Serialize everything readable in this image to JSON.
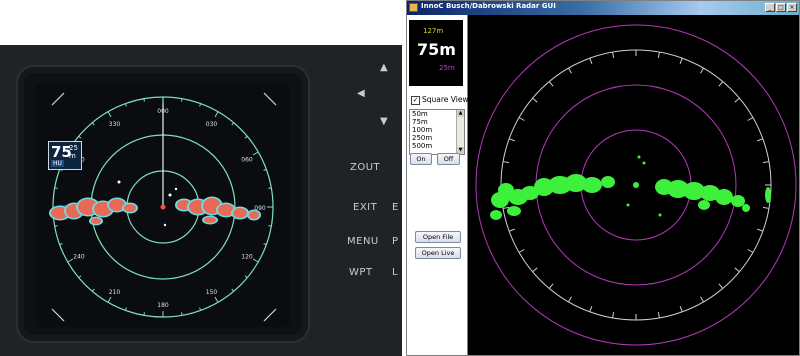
{
  "photo": {
    "range_value": "75",
    "range_unit_top": "25",
    "range_unit_bottom": "m",
    "mode_badge": "HU",
    "bearing_labels": [
      "000",
      "030",
      "060",
      "090",
      "120",
      "150",
      "180",
      "210",
      "240",
      "270",
      "300",
      "330"
    ],
    "side_buttons": [
      "ZOUT",
      "EXIT",
      "MENU",
      "WPT"
    ],
    "side_button_subs": [
      "E",
      "P",
      "L"
    ],
    "colors": {
      "target": "#e86a55",
      "ring": "#7fe0c0",
      "screen": "#0a0c10"
    }
  },
  "window": {
    "title": "InnoC Busch/Dabrowski Radar GUI",
    "minimize_label": "_",
    "maximize_label": "□",
    "close_label": "×",
    "readout": {
      "top_value": "127m",
      "main_value": "75m",
      "bottom_value": "25m"
    },
    "square_view": {
      "label": "Square View",
      "checked": true,
      "check_mark": "✓"
    },
    "range_options": [
      "50m",
      "75m",
      "100m",
      "250m",
      "500m"
    ],
    "scroll_up_icon": "▲",
    "scroll_down_icon": "▼",
    "on_label": "On",
    "off_label": "Off",
    "open_file_label": "Open File",
    "open_live_label": "Open Live",
    "colors": {
      "target": "#3cf03c",
      "inner_rings": "#b23ab8",
      "outer_ring": "#d0d0d0"
    }
  }
}
